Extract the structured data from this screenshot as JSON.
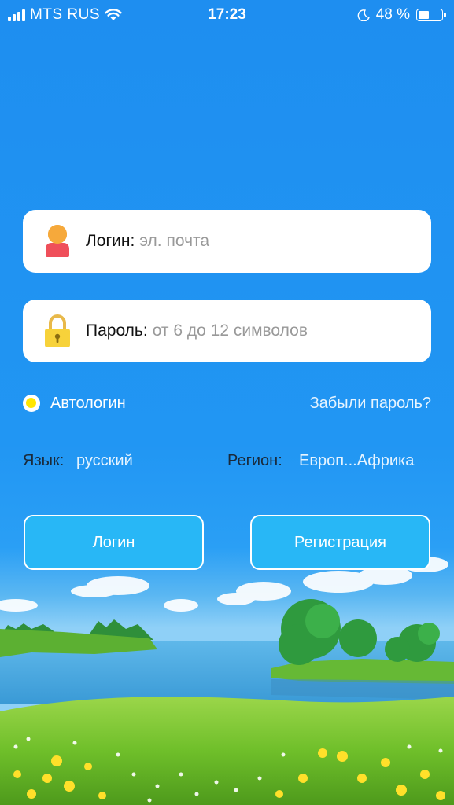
{
  "status_bar": {
    "carrier": "MTS RUS",
    "time": "17:23",
    "battery_percent": "48 %",
    "battery_level": 0.48
  },
  "login_field": {
    "label": "Логин:",
    "placeholder": "эл. почта",
    "value": ""
  },
  "password_field": {
    "label": "Пароль:",
    "placeholder": "от 6 до 12 символов",
    "value": ""
  },
  "options": {
    "autologin_label": "Автологин",
    "autologin_checked": true,
    "forgot_password": "Забыли пароль?"
  },
  "settings": {
    "language_label": "Язык:",
    "language_value": "русский",
    "region_label": "Регион:",
    "region_value": "Европ...Африка"
  },
  "buttons": {
    "login": "Логин",
    "register": "Регистрация"
  },
  "colors": {
    "sky": "#2196f3",
    "button_fill": "#28b7f6",
    "link": "#e6f4ff",
    "autologin_dot": "#ffe600"
  },
  "icons": {
    "login": "user-icon",
    "password": "lock-icon",
    "status": [
      "signal-icon",
      "wifi-icon",
      "moon-icon",
      "battery-icon"
    ]
  }
}
